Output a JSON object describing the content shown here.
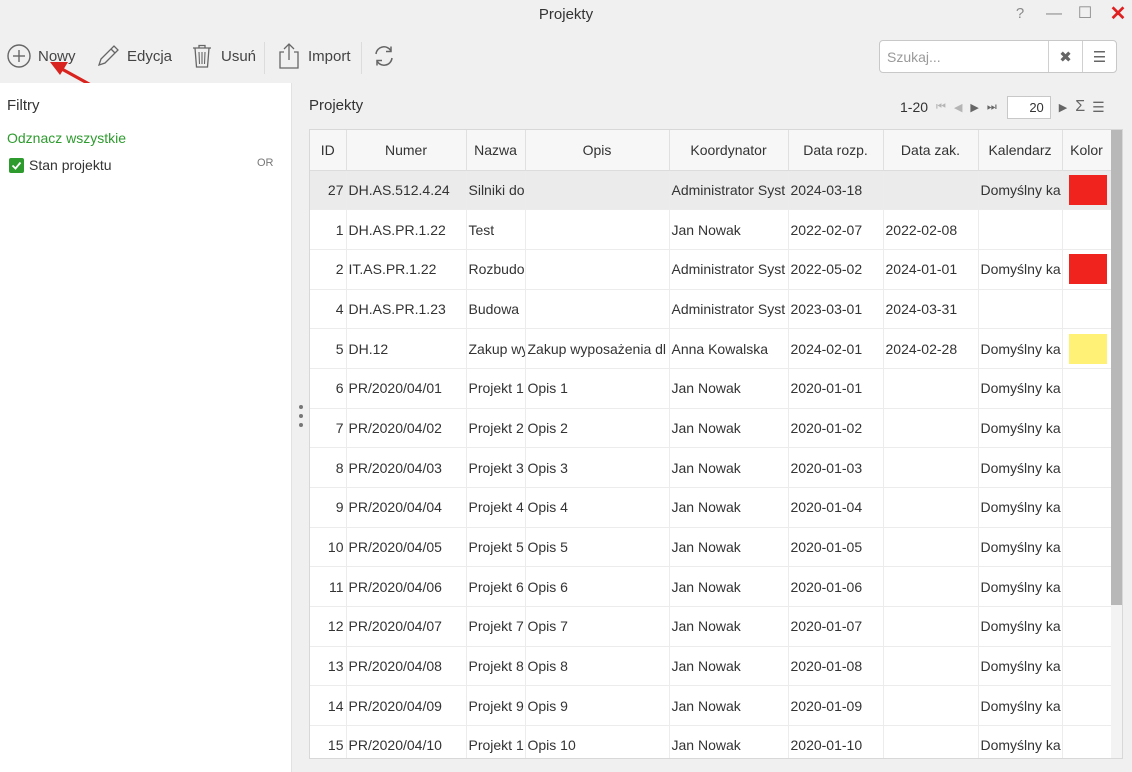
{
  "window": {
    "title": "Projekty",
    "controls": {
      "help": "?",
      "minimize": "—",
      "maximize": "☐",
      "close": "✕"
    }
  },
  "toolbar": {
    "new_label": "Nowy",
    "edit_label": "Edycja",
    "delete_label": "Usuń",
    "import_label": "Import",
    "refresh_icon": "refresh-icon"
  },
  "search": {
    "placeholder": "Szukaj...",
    "value": ""
  },
  "filters": {
    "title": "Filtry",
    "select_all": "Odznacz wszystkie",
    "items": [
      {
        "label": "Stan projektu",
        "checked": true,
        "logic": "OR"
      }
    ]
  },
  "grid": {
    "title": "Projekty",
    "pager": {
      "range": "1-20",
      "page_size": "20"
    },
    "columns": [
      "ID",
      "Numer",
      "Nazwa",
      "Opis",
      "Koordynator",
      "Data rozp.",
      "Data zak.",
      "Kalendarz",
      "Kolor"
    ],
    "rows": [
      {
        "id": "27",
        "numer": "DH.AS.512.4.24",
        "nazwa": "Silniki do",
        "opis": "",
        "koordynator": "Administrator Syst",
        "data_rozp": "2024-03-18",
        "data_zak": "",
        "kalendarz": "Domyślny ka",
        "kolor": "#f0231f",
        "selected": true
      },
      {
        "id": "1",
        "numer": "DH.AS.PR.1.22",
        "nazwa": "Test",
        "opis": "",
        "koordynator": "Jan Nowak",
        "data_rozp": "2022-02-07",
        "data_zak": "2022-02-08",
        "kalendarz": "",
        "kolor": ""
      },
      {
        "id": "2",
        "numer": "IT.AS.PR.1.22",
        "nazwa": "Rozbudo",
        "opis": "",
        "koordynator": "Administrator Syst",
        "data_rozp": "2022-05-02",
        "data_zak": "2024-01-01",
        "kalendarz": "Domyślny ka",
        "kolor": "#f0231f"
      },
      {
        "id": "4",
        "numer": "DH.AS.PR.1.23",
        "nazwa": "Budowa",
        "opis": "",
        "koordynator": "Administrator Syst",
        "data_rozp": "2023-03-01",
        "data_zak": "2024-03-31",
        "kalendarz": "",
        "kolor": ""
      },
      {
        "id": "5",
        "numer": "DH.12",
        "nazwa": "Zakup wy",
        "opis": "Zakup wyposażenia dl",
        "koordynator": "Anna Kowalska",
        "data_rozp": "2024-02-01",
        "data_zak": "2024-02-28",
        "kalendarz": "Domyślny ka",
        "kolor": "#fff176"
      },
      {
        "id": "6",
        "numer": "PR/2020/04/01",
        "nazwa": "Projekt 1",
        "opis": "Opis 1",
        "koordynator": "Jan Nowak",
        "data_rozp": "2020-01-01",
        "data_zak": "",
        "kalendarz": "Domyślny ka",
        "kolor": ""
      },
      {
        "id": "7",
        "numer": "PR/2020/04/02",
        "nazwa": "Projekt 2",
        "opis": "Opis 2",
        "koordynator": "Jan Nowak",
        "data_rozp": "2020-01-02",
        "data_zak": "",
        "kalendarz": "Domyślny ka",
        "kolor": ""
      },
      {
        "id": "8",
        "numer": "PR/2020/04/03",
        "nazwa": "Projekt 3",
        "opis": "Opis 3",
        "koordynator": "Jan Nowak",
        "data_rozp": "2020-01-03",
        "data_zak": "",
        "kalendarz": "Domyślny ka",
        "kolor": ""
      },
      {
        "id": "9",
        "numer": "PR/2020/04/04",
        "nazwa": "Projekt 4",
        "opis": "Opis 4",
        "koordynator": "Jan Nowak",
        "data_rozp": "2020-01-04",
        "data_zak": "",
        "kalendarz": "Domyślny ka",
        "kolor": ""
      },
      {
        "id": "10",
        "numer": "PR/2020/04/05",
        "nazwa": "Projekt 5",
        "opis": "Opis 5",
        "koordynator": "Jan Nowak",
        "data_rozp": "2020-01-05",
        "data_zak": "",
        "kalendarz": "Domyślny ka",
        "kolor": ""
      },
      {
        "id": "11",
        "numer": "PR/2020/04/06",
        "nazwa": "Projekt 6",
        "opis": "Opis 6",
        "koordynator": "Jan Nowak",
        "data_rozp": "2020-01-06",
        "data_zak": "",
        "kalendarz": "Domyślny ka",
        "kolor": ""
      },
      {
        "id": "12",
        "numer": "PR/2020/04/07",
        "nazwa": "Projekt 7",
        "opis": "Opis 7",
        "koordynator": "Jan Nowak",
        "data_rozp": "2020-01-07",
        "data_zak": "",
        "kalendarz": "Domyślny ka",
        "kolor": ""
      },
      {
        "id": "13",
        "numer": "PR/2020/04/08",
        "nazwa": "Projekt 8",
        "opis": "Opis 8",
        "koordynator": "Jan Nowak",
        "data_rozp": "2020-01-08",
        "data_zak": "",
        "kalendarz": "Domyślny ka",
        "kolor": ""
      },
      {
        "id": "14",
        "numer": "PR/2020/04/09",
        "nazwa": "Projekt 9",
        "opis": "Opis 9",
        "koordynator": "Jan Nowak",
        "data_rozp": "2020-01-09",
        "data_zak": "",
        "kalendarz": "Domyślny ka",
        "kolor": ""
      },
      {
        "id": "15",
        "numer": "PR/2020/04/10",
        "nazwa": "Projekt 1",
        "opis": "Opis 10",
        "koordynator": "Jan Nowak",
        "data_rozp": "2020-01-10",
        "data_zak": "",
        "kalendarz": "Domyślny ka",
        "kolor": ""
      }
    ]
  },
  "colors": {
    "accent_green": "#2e9b2e",
    "close_red": "#e02020",
    "annotation_arrow": "#d9231e",
    "selected_row": "#ebebeb"
  }
}
